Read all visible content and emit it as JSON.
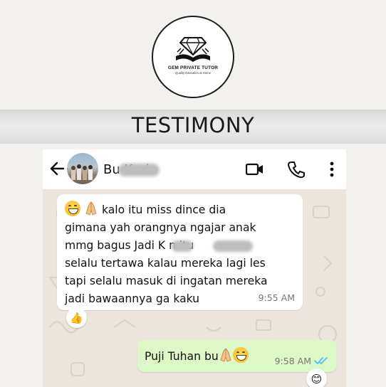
{
  "logo": {
    "brand": "GEM PRIVATE TUTOR",
    "tagline": "Quality Education at Home"
  },
  "banner": {
    "title": "TESTIMONY"
  },
  "chat": {
    "header": {
      "contact_name": "Bu Karin",
      "icons": [
        "back-arrow-icon",
        "video-call-icon",
        "phone-icon",
        "more-vert-icon"
      ]
    },
    "incoming": {
      "text": "kalo itu miss dince dia\ngimana yah orangnya ngajar anak\nmmg bagus Jadi K       n         itu\nselalu tertawa kalau mereka lagi les\ntapi selalu masuk di ingatan mereka\njadi bawaannya ga kaku",
      "time": "9:55 AM",
      "reaction": "👍"
    },
    "outgoing": {
      "text": "Puji Tuhan bu",
      "time": "9:58 AM",
      "reaction": "😊"
    },
    "colors": {
      "incoming_bg": "#ffffff",
      "outgoing_bg": "#dcf8c6",
      "wallpaper": "#ece5dd",
      "read_ticks": "#4fc3f7"
    }
  }
}
